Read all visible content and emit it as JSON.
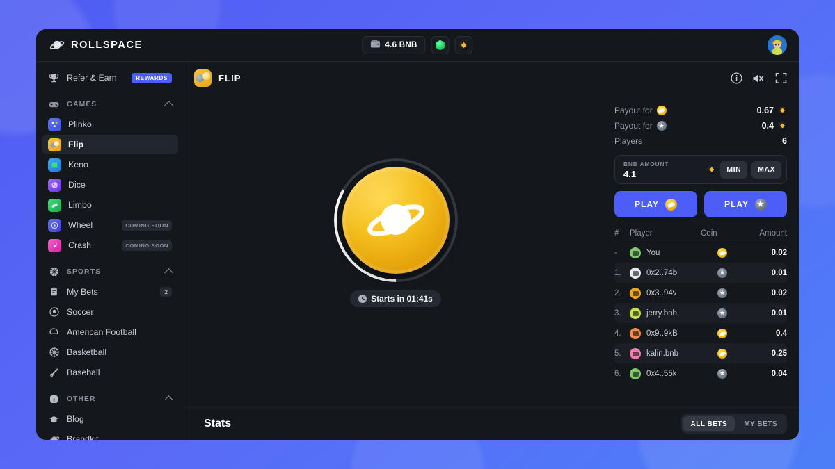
{
  "brand": {
    "name": "ROLLSPACE",
    "icon": "saturn-icon"
  },
  "topbar": {
    "balance_amount": "4.6 BNB",
    "wallet_icon": "wallet-icon",
    "gem_icon": "gem-icon",
    "bnb_icon": "bnb-coin-icon",
    "avatar_icon": "user-avatar"
  },
  "sidebar": {
    "refer": {
      "label": "Refer & Earn",
      "badge": "REWARDS",
      "icon": "trophy-icon"
    },
    "groups": [
      {
        "title": "GAMES",
        "icon": "gamepad-icon",
        "items": [
          {
            "label": "Plinko",
            "icon": "plinko-icon",
            "color1": "#5b6ef0",
            "color2": "#3c4fd6",
            "glyph": "⚙",
            "badge": "",
            "active": false
          },
          {
            "label": "Flip",
            "icon": "flip-icon",
            "color1": "#f7c53b",
            "color2": "#e8a21c",
            "glyph": "●",
            "badge": "",
            "active": true
          },
          {
            "label": "Keno",
            "icon": "keno-icon",
            "color1": "#3aa7f0",
            "color2": "#1f7ed4",
            "glyph": "◆",
            "badge": "",
            "active": false
          },
          {
            "label": "Dice",
            "icon": "dice-icon",
            "color1": "#8b5cf6",
            "color2": "#6b35e0",
            "glyph": "⚀",
            "badge": "",
            "active": false
          },
          {
            "label": "Limbo",
            "icon": "limbo-icon",
            "color1": "#34d06a",
            "color2": "#17a84c",
            "glyph": "↗",
            "badge": "",
            "active": false
          },
          {
            "label": "Wheel",
            "icon": "wheel-icon",
            "color1": "#5f63f2",
            "color2": "#3a3fd0",
            "glyph": "◎",
            "badge": "COMING SOON",
            "active": false
          },
          {
            "label": "Crash",
            "icon": "crash-icon",
            "color1": "#f250c8",
            "color2": "#d41fa0",
            "glyph": "↗",
            "badge": "",
            "active": false,
            "badge2": "COMING SOON"
          }
        ]
      },
      {
        "title": "SPORTS",
        "icon": "basketball-icon",
        "items": [
          {
            "label": "My Bets",
            "icon": "clipboard-icon",
            "count": "2"
          },
          {
            "label": "Soccer",
            "icon": "soccer-ball-icon"
          },
          {
            "label": "American Football",
            "icon": "football-helmet-icon"
          },
          {
            "label": "Basketball",
            "icon": "basketball-icon"
          },
          {
            "label": "Baseball",
            "icon": "baseball-bat-icon"
          }
        ]
      },
      {
        "title": "OTHER",
        "icon": "info-icon",
        "items": [
          {
            "label": "Blog",
            "icon": "graduation-cap-icon"
          },
          {
            "label": "Brandkit",
            "icon": "saturn-icon"
          }
        ]
      }
    ]
  },
  "game": {
    "title": "FLIP",
    "icon": "flip-game-icon",
    "controls": [
      {
        "name": "info-icon"
      },
      {
        "name": "mute-icon"
      },
      {
        "name": "fullscreen-icon"
      }
    ],
    "timer": "Starts in 01:41s",
    "coin_face": "saturn-gold-coin"
  },
  "panel": {
    "payout_gold_label": "Payout for",
    "payout_gold_value": "0.67",
    "payout_silver_label": "Payout for",
    "payout_silver_value": "0.4",
    "players_label": "Players",
    "players_value": "6",
    "amount_caption": "BNB AMOUNT",
    "amount_value": "4.1",
    "min_label": "MIN",
    "max_label": "MAX",
    "play_gold_label": "PLAY",
    "play_silver_label": "PLAY"
  },
  "bets": {
    "headers": {
      "num": "#",
      "player": "Player",
      "coin": "Coin",
      "amount": "Amount"
    },
    "rows": [
      {
        "num": "-",
        "player": "You",
        "coin": "gold",
        "amount": "0.02",
        "avatar": "#7ec96a"
      },
      {
        "num": "1.",
        "player": "0x2..74b",
        "coin": "silver",
        "amount": "0.01",
        "avatar": "#e8edf2"
      },
      {
        "num": "2.",
        "player": "0x3..94v",
        "coin": "silver",
        "amount": "0.02",
        "avatar": "#f2a81e"
      },
      {
        "num": "3.",
        "player": "jerry.bnb",
        "coin": "silver",
        "amount": "0.01",
        "avatar": "#c3e34f"
      },
      {
        "num": "4.",
        "player": "0x9..9kB",
        "coin": "gold",
        "amount": "0.4",
        "avatar": "#ef8a4c"
      },
      {
        "num": "5.",
        "player": "kalin.bnb",
        "coin": "gold",
        "amount": "0.25",
        "avatar": "#ef7fae"
      },
      {
        "num": "6.",
        "player": "0x4..55k",
        "coin": "silver",
        "amount": "0.04",
        "avatar": "#7ec96a"
      }
    ]
  },
  "footer": {
    "stats_title": "Stats",
    "tab_all": "ALL BETS",
    "tab_my": "MY BETS"
  }
}
